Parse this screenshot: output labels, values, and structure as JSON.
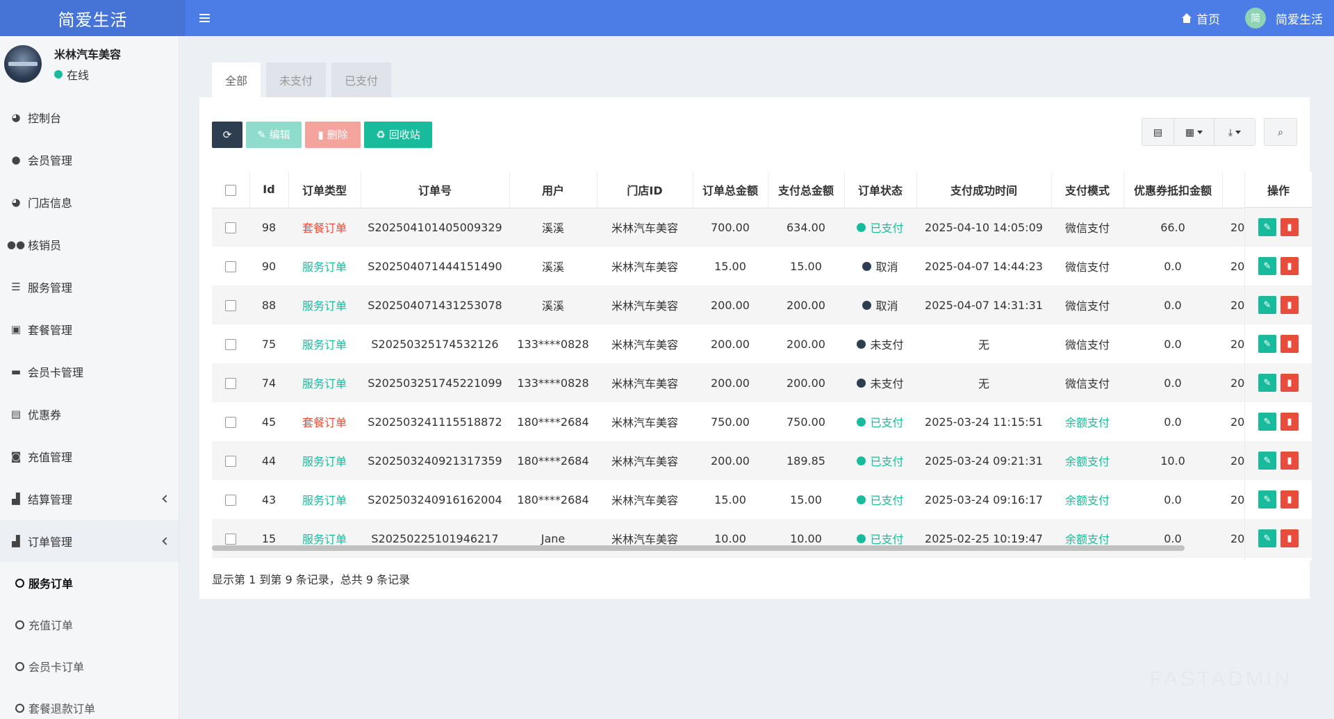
{
  "app": {
    "brand": "简爱生活",
    "home_label": "首页",
    "user_avatar_char": "简",
    "user_label": "简爱生活"
  },
  "user_panel": {
    "name": "米林汽车美容",
    "status": "在线"
  },
  "sidebar": {
    "items": [
      {
        "label": "控制台",
        "icon": "dashboard-icon",
        "glyph": "◕"
      },
      {
        "label": "会员管理",
        "icon": "user-icon",
        "glyph": "●"
      },
      {
        "label": "门店信息",
        "icon": "dashboard-icon",
        "glyph": "◕"
      },
      {
        "label": "核销员",
        "icon": "users-icon",
        "glyph": "●●"
      },
      {
        "label": "服务管理",
        "icon": "list-icon",
        "glyph": "☰"
      },
      {
        "label": "套餐管理",
        "icon": "gift-icon",
        "glyph": "▣"
      },
      {
        "label": "会员卡管理",
        "icon": "credit-card-icon",
        "glyph": "▬"
      },
      {
        "label": "优惠券",
        "icon": "coupon-icon",
        "glyph": "▤"
      },
      {
        "label": "充值管理",
        "icon": "money-icon",
        "glyph": "◙"
      },
      {
        "label": "结算管理",
        "icon": "briefcase-icon",
        "glyph": "▟"
      },
      {
        "label": "订单管理",
        "icon": "briefcase-icon",
        "glyph": "▟"
      }
    ],
    "sub_items": [
      {
        "label": "服务订单",
        "active": true
      },
      {
        "label": "充值订单",
        "active": false
      },
      {
        "label": "会员卡订单",
        "active": false
      },
      {
        "label": "套餐退款订单",
        "active": false
      }
    ]
  },
  "tabs": [
    "全部",
    "未支付",
    "已支付"
  ],
  "toolbar": {
    "edit_label": "编辑",
    "delete_label": "删除",
    "recycle_label": "回收站"
  },
  "table": {
    "headers": [
      "Id",
      "订单类型",
      "订单号",
      "用户",
      "门店ID",
      "订单总金额",
      "支付总金额",
      "订单状态",
      "支付成功时间",
      "支付模式",
      "优惠券抵扣金额"
    ],
    "ops_header": "操作",
    "rows": [
      {
        "id": "98",
        "type": "套餐订单",
        "type_kind": "combo",
        "order_no": "S202504101405009329",
        "user": "溪溪",
        "store": "米林汽车美容",
        "total": "700.00",
        "paid": "634.00",
        "status": "已支付",
        "status_kind": "paid",
        "pay_time": "2025-04-10 14:05:09",
        "pay_mode": "微信支付",
        "pay_kind": "wechat",
        "coupon": "66.0",
        "extra": "20"
      },
      {
        "id": "90",
        "type": "服务订单",
        "type_kind": "service",
        "order_no": "S202504071444151490",
        "user": "溪溪",
        "store": "米林汽车美容",
        "total": "15.00",
        "paid": "15.00",
        "status": "取消",
        "status_kind": "cancel",
        "pay_time": "2025-04-07 14:44:23",
        "pay_mode": "微信支付",
        "pay_kind": "wechat",
        "coupon": "0.0",
        "extra": "20"
      },
      {
        "id": "88",
        "type": "服务订单",
        "type_kind": "service",
        "order_no": "S202504071431253078",
        "user": "溪溪",
        "store": "米林汽车美容",
        "total": "200.00",
        "paid": "200.00",
        "status": "取消",
        "status_kind": "cancel",
        "pay_time": "2025-04-07 14:31:31",
        "pay_mode": "微信支付",
        "pay_kind": "wechat",
        "coupon": "0.0",
        "extra": "20"
      },
      {
        "id": "75",
        "type": "服务订单",
        "type_kind": "service",
        "order_no": "S20250325174532126",
        "user": "133****0828",
        "store": "米林汽车美容",
        "total": "200.00",
        "paid": "200.00",
        "status": "未支付",
        "status_kind": "unpaid",
        "pay_time": "无",
        "pay_mode": "微信支付",
        "pay_kind": "wechat",
        "coupon": "0.0",
        "extra": "20"
      },
      {
        "id": "74",
        "type": "服务订单",
        "type_kind": "service",
        "order_no": "S202503251745221099",
        "user": "133****0828",
        "store": "米林汽车美容",
        "total": "200.00",
        "paid": "200.00",
        "status": "未支付",
        "status_kind": "unpaid",
        "pay_time": "无",
        "pay_mode": "微信支付",
        "pay_kind": "wechat",
        "coupon": "0.0",
        "extra": "20"
      },
      {
        "id": "45",
        "type": "套餐订单",
        "type_kind": "combo",
        "order_no": "S202503241115518872",
        "user": "180****2684",
        "store": "米林汽车美容",
        "total": "750.00",
        "paid": "750.00",
        "status": "已支付",
        "status_kind": "paid",
        "pay_time": "2025-03-24 11:15:51",
        "pay_mode": "余额支付",
        "pay_kind": "balance",
        "coupon": "0.0",
        "extra": "20"
      },
      {
        "id": "44",
        "type": "服务订单",
        "type_kind": "service",
        "order_no": "S202503240921317359",
        "user": "180****2684",
        "store": "米林汽车美容",
        "total": "200.00",
        "paid": "189.85",
        "status": "已支付",
        "status_kind": "paid",
        "pay_time": "2025-03-24 09:21:31",
        "pay_mode": "余额支付",
        "pay_kind": "balance",
        "coupon": "10.0",
        "extra": "20"
      },
      {
        "id": "43",
        "type": "服务订单",
        "type_kind": "service",
        "order_no": "S202503240916162004",
        "user": "180****2684",
        "store": "米林汽车美容",
        "total": "15.00",
        "paid": "15.00",
        "status": "已支付",
        "status_kind": "paid",
        "pay_time": "2025-03-24 09:16:17",
        "pay_mode": "余额支付",
        "pay_kind": "balance",
        "coupon": "0.0",
        "extra": "20"
      },
      {
        "id": "15",
        "type": "服务订单",
        "type_kind": "service",
        "order_no": "S20250225101946217",
        "user": "Jane",
        "store": "米林汽车美容",
        "total": "10.00",
        "paid": "10.00",
        "status": "已支付",
        "status_kind": "paid",
        "pay_time": "2025-02-25 10:19:47",
        "pay_mode": "余额支付",
        "pay_kind": "balance",
        "coupon": "0.0",
        "extra": "20"
      }
    ]
  },
  "footer": {
    "summary": "显示第 1 到第 9 条记录，总共 9 条记录"
  },
  "watermark": "FASTADMIN",
  "colors": {
    "topbar": "#4c7de6",
    "success": "#18bc9c",
    "danger": "#e74c3c",
    "dark": "#2c3e50"
  }
}
